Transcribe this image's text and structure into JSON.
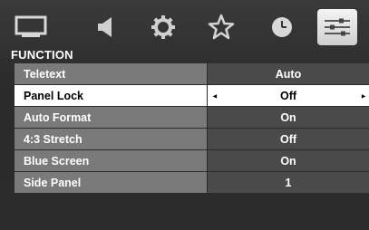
{
  "tabs": [
    {
      "icon": "picture-icon"
    },
    {
      "icon": "sound-icon"
    },
    {
      "icon": "setup-gear-icon"
    },
    {
      "icon": "preferences-star-icon"
    },
    {
      "icon": "timer-clock-icon"
    },
    {
      "icon": "function-sliders-icon",
      "active": true
    }
  ],
  "category_title": "FUNCTION",
  "menu": {
    "items": [
      {
        "label": "Teletext",
        "value": "Auto"
      },
      {
        "label": "Panel Lock",
        "value": "Off",
        "selected": true
      },
      {
        "label": "Auto Format",
        "value": "On"
      },
      {
        "label": "4:3 Stretch",
        "value": "Off"
      },
      {
        "label": "Blue Screen",
        "value": "On"
      },
      {
        "label": "Side Panel",
        "value": "1"
      }
    ],
    "arrow_left": "◂",
    "arrow_right": "▸"
  },
  "colors": {
    "background": "#2f2f2f",
    "label_bg": "#7a7a7a",
    "value_bg": "#4a4a4a",
    "selected_bg": "#ffffff",
    "text": "#ffffff",
    "selected_text": "#000000"
  }
}
